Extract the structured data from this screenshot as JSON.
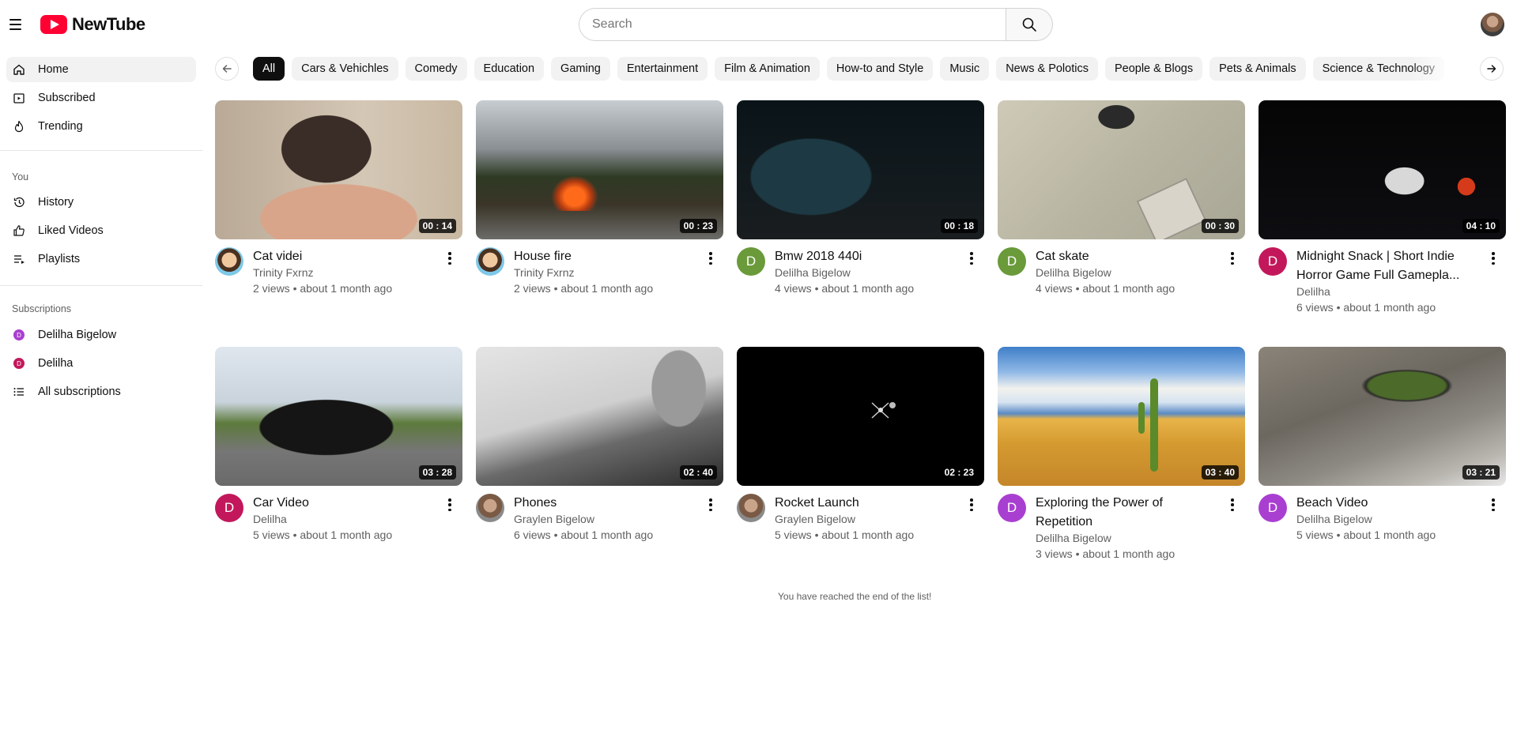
{
  "app": {
    "name": "NewTube"
  },
  "search": {
    "placeholder": "Search"
  },
  "sidebar": {
    "main": [
      {
        "label": "Home",
        "icon": "home-icon"
      },
      {
        "label": "Subscribed",
        "icon": "subscriptions-icon"
      },
      {
        "label": "Trending",
        "icon": "flame-icon"
      }
    ],
    "you_heading": "You",
    "you": [
      {
        "label": "History",
        "icon": "history-icon"
      },
      {
        "label": "Liked Videos",
        "icon": "thumb-up-icon"
      },
      {
        "label": "Playlists",
        "icon": "playlist-icon"
      }
    ],
    "subscriptions_heading": "Subscriptions",
    "subscriptions": [
      {
        "label": "Delilha Bigelow",
        "initial": "D",
        "color": "#a93fd1"
      },
      {
        "label": "Delilha",
        "initial": "D",
        "color": "#c2185b"
      },
      {
        "label": "All subscriptions",
        "icon": "list-icon"
      }
    ]
  },
  "chips": [
    "All",
    "Cars & Vehichles",
    "Comedy",
    "Education",
    "Gaming",
    "Entertainment",
    "Film & Animation",
    "How-to and Style",
    "Music",
    "News & Polotics",
    "People & Blogs",
    "Pets & Animals",
    "Science & Technology"
  ],
  "videos": [
    {
      "title": "Cat videi",
      "channel": "Trinity Fxrnz",
      "stats": "2 views • about 1 month ago",
      "duration": "00 : 14"
    },
    {
      "title": "House fire",
      "channel": "Trinity Fxrnz",
      "stats": "2 views • about 1 month ago",
      "duration": "00 : 23"
    },
    {
      "title": "Bmw 2018 440i",
      "channel": "Delilha Bigelow",
      "stats": "4 views • about 1 month ago",
      "duration": "00 : 18"
    },
    {
      "title": "Cat skate",
      "channel": "Delilha Bigelow",
      "stats": "4 views • about 1 month ago",
      "duration": "00 : 30"
    },
    {
      "title": "Midnight Snack | Short Indie Horror Game Full Gamepla...",
      "channel": "Delilha",
      "stats": "6 views • about 1 month ago",
      "duration": "04 : 10"
    },
    {
      "title": "Car Video",
      "channel": "Delilha",
      "stats": "5 views • about 1 month ago",
      "duration": "03 : 28"
    },
    {
      "title": "Phones",
      "channel": "Graylen Bigelow",
      "stats": "6 views • about 1 month ago",
      "duration": "02 : 40"
    },
    {
      "title": "Rocket Launch",
      "channel": "Graylen Bigelow",
      "stats": "5 views • about 1 month ago",
      "duration": "02 : 23"
    },
    {
      "title": "Exploring the Power of Repetition",
      "channel": "Delilha Bigelow",
      "stats": "3 views • about 1 month ago",
      "duration": "03 : 40"
    },
    {
      "title": "Beach Video",
      "channel": "Delilha Bigelow",
      "stats": "5 views • about 1 month ago",
      "duration": "03 : 21"
    }
  ],
  "end_message": "You have reached the end of the list!"
}
